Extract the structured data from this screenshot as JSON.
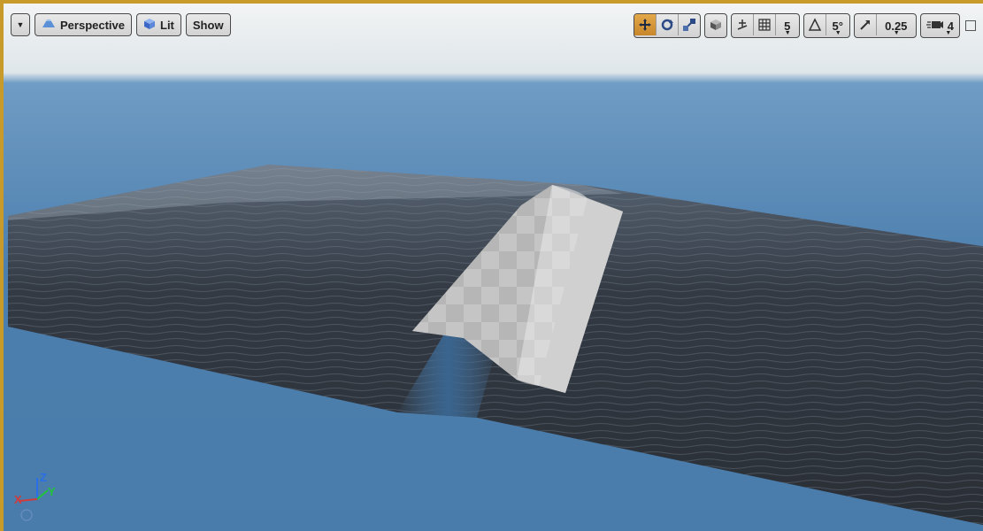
{
  "toolbar": {
    "view_mode": "Perspective",
    "lighting": "Lit",
    "show": "Show"
  },
  "snap": {
    "grid_value": "5",
    "rotation_value": "5°",
    "scale_value": "0.25",
    "camera_speed": "4"
  },
  "axes": {
    "x": "X",
    "y": "Y",
    "z": "Z"
  },
  "colors": {
    "sky_top": "#4f80ad",
    "horizon": "#e8ecee",
    "water": "#2e353e",
    "ramp": "#bdbdbd",
    "accent": "#c89a2a"
  },
  "icons": [
    "dropdown-caret-icon",
    "perspective-icon",
    "lit-cube-icon",
    "translate-icon",
    "rotate-icon",
    "scale-icon",
    "world-local-icon",
    "surface-snap-icon",
    "grid-snap-icon",
    "rotation-snap-icon",
    "scale-snap-icon",
    "camera-speed-icon",
    "maximize-icon"
  ]
}
